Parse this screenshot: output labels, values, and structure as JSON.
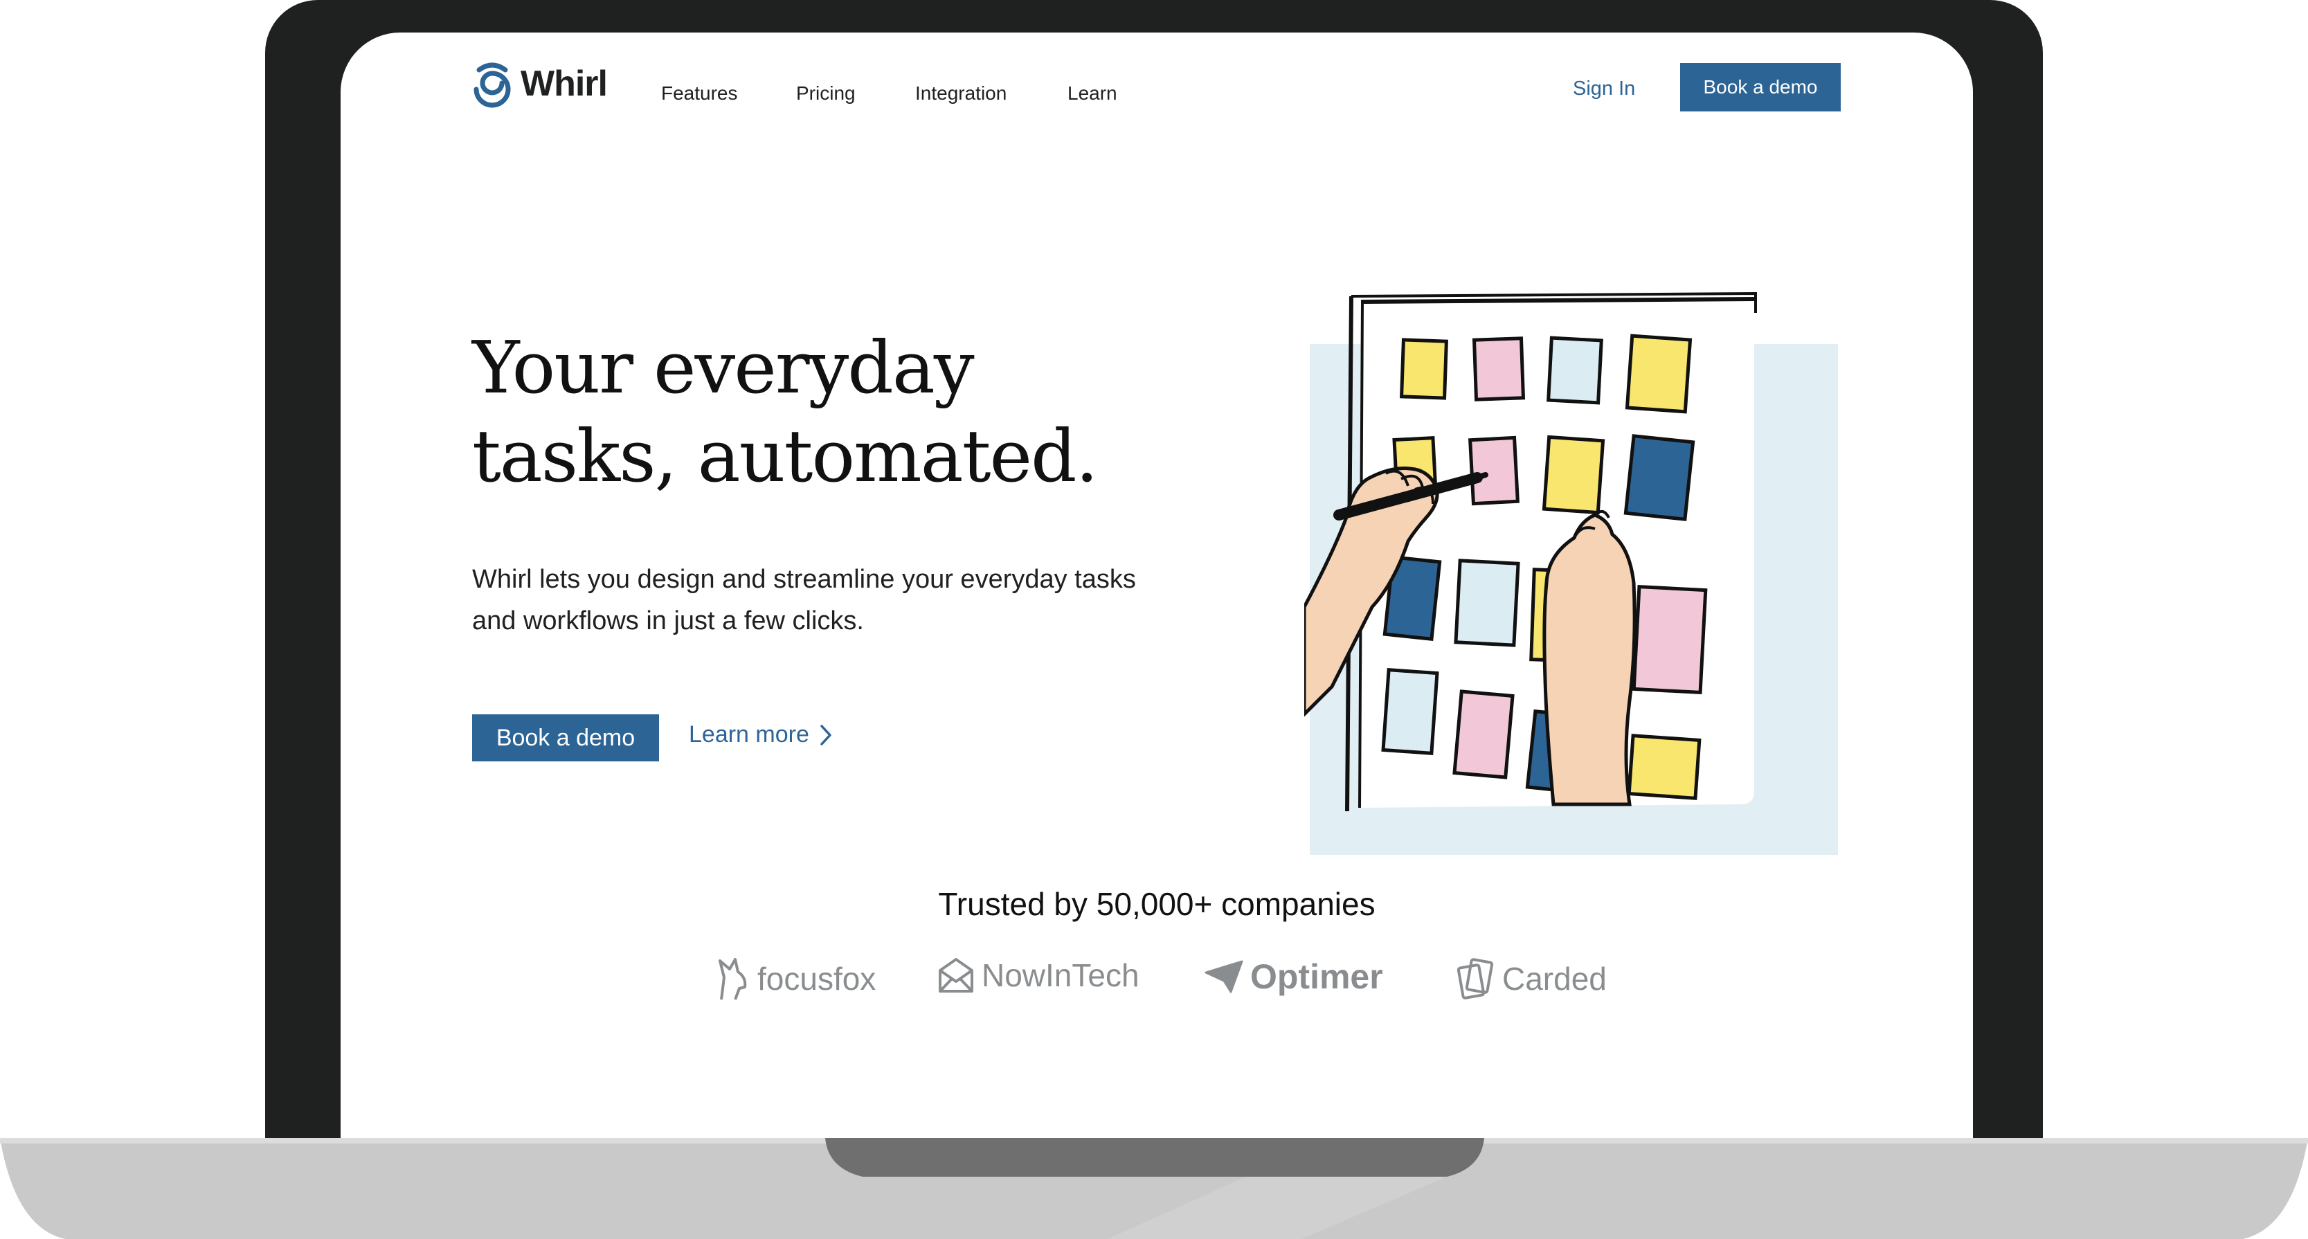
{
  "brand": {
    "name": "Whirl",
    "accent": "#2c6496"
  },
  "nav": {
    "links": [
      "Features",
      "Pricing",
      "Integration",
      "Learn"
    ],
    "sign_in": "Sign In",
    "book_demo": "Book a demo"
  },
  "hero": {
    "title": "Your everyday\ntasks, automated.",
    "subtitle": "Whirl lets you design and streamline your everyday tasks and workflows in just a few clicks.",
    "cta_primary": "Book a demo",
    "cta_secondary": "Learn more"
  },
  "trust": {
    "heading": "Trusted by 50,000+ companies",
    "logos": [
      {
        "name": "focusfox",
        "icon": "fox-icon"
      },
      {
        "name": "NowInTech",
        "icon": "envelope-icon"
      },
      {
        "name": "Optimer",
        "icon": "paper-plane-icon"
      },
      {
        "name": "Carded",
        "icon": "cards-icon"
      }
    ]
  }
}
